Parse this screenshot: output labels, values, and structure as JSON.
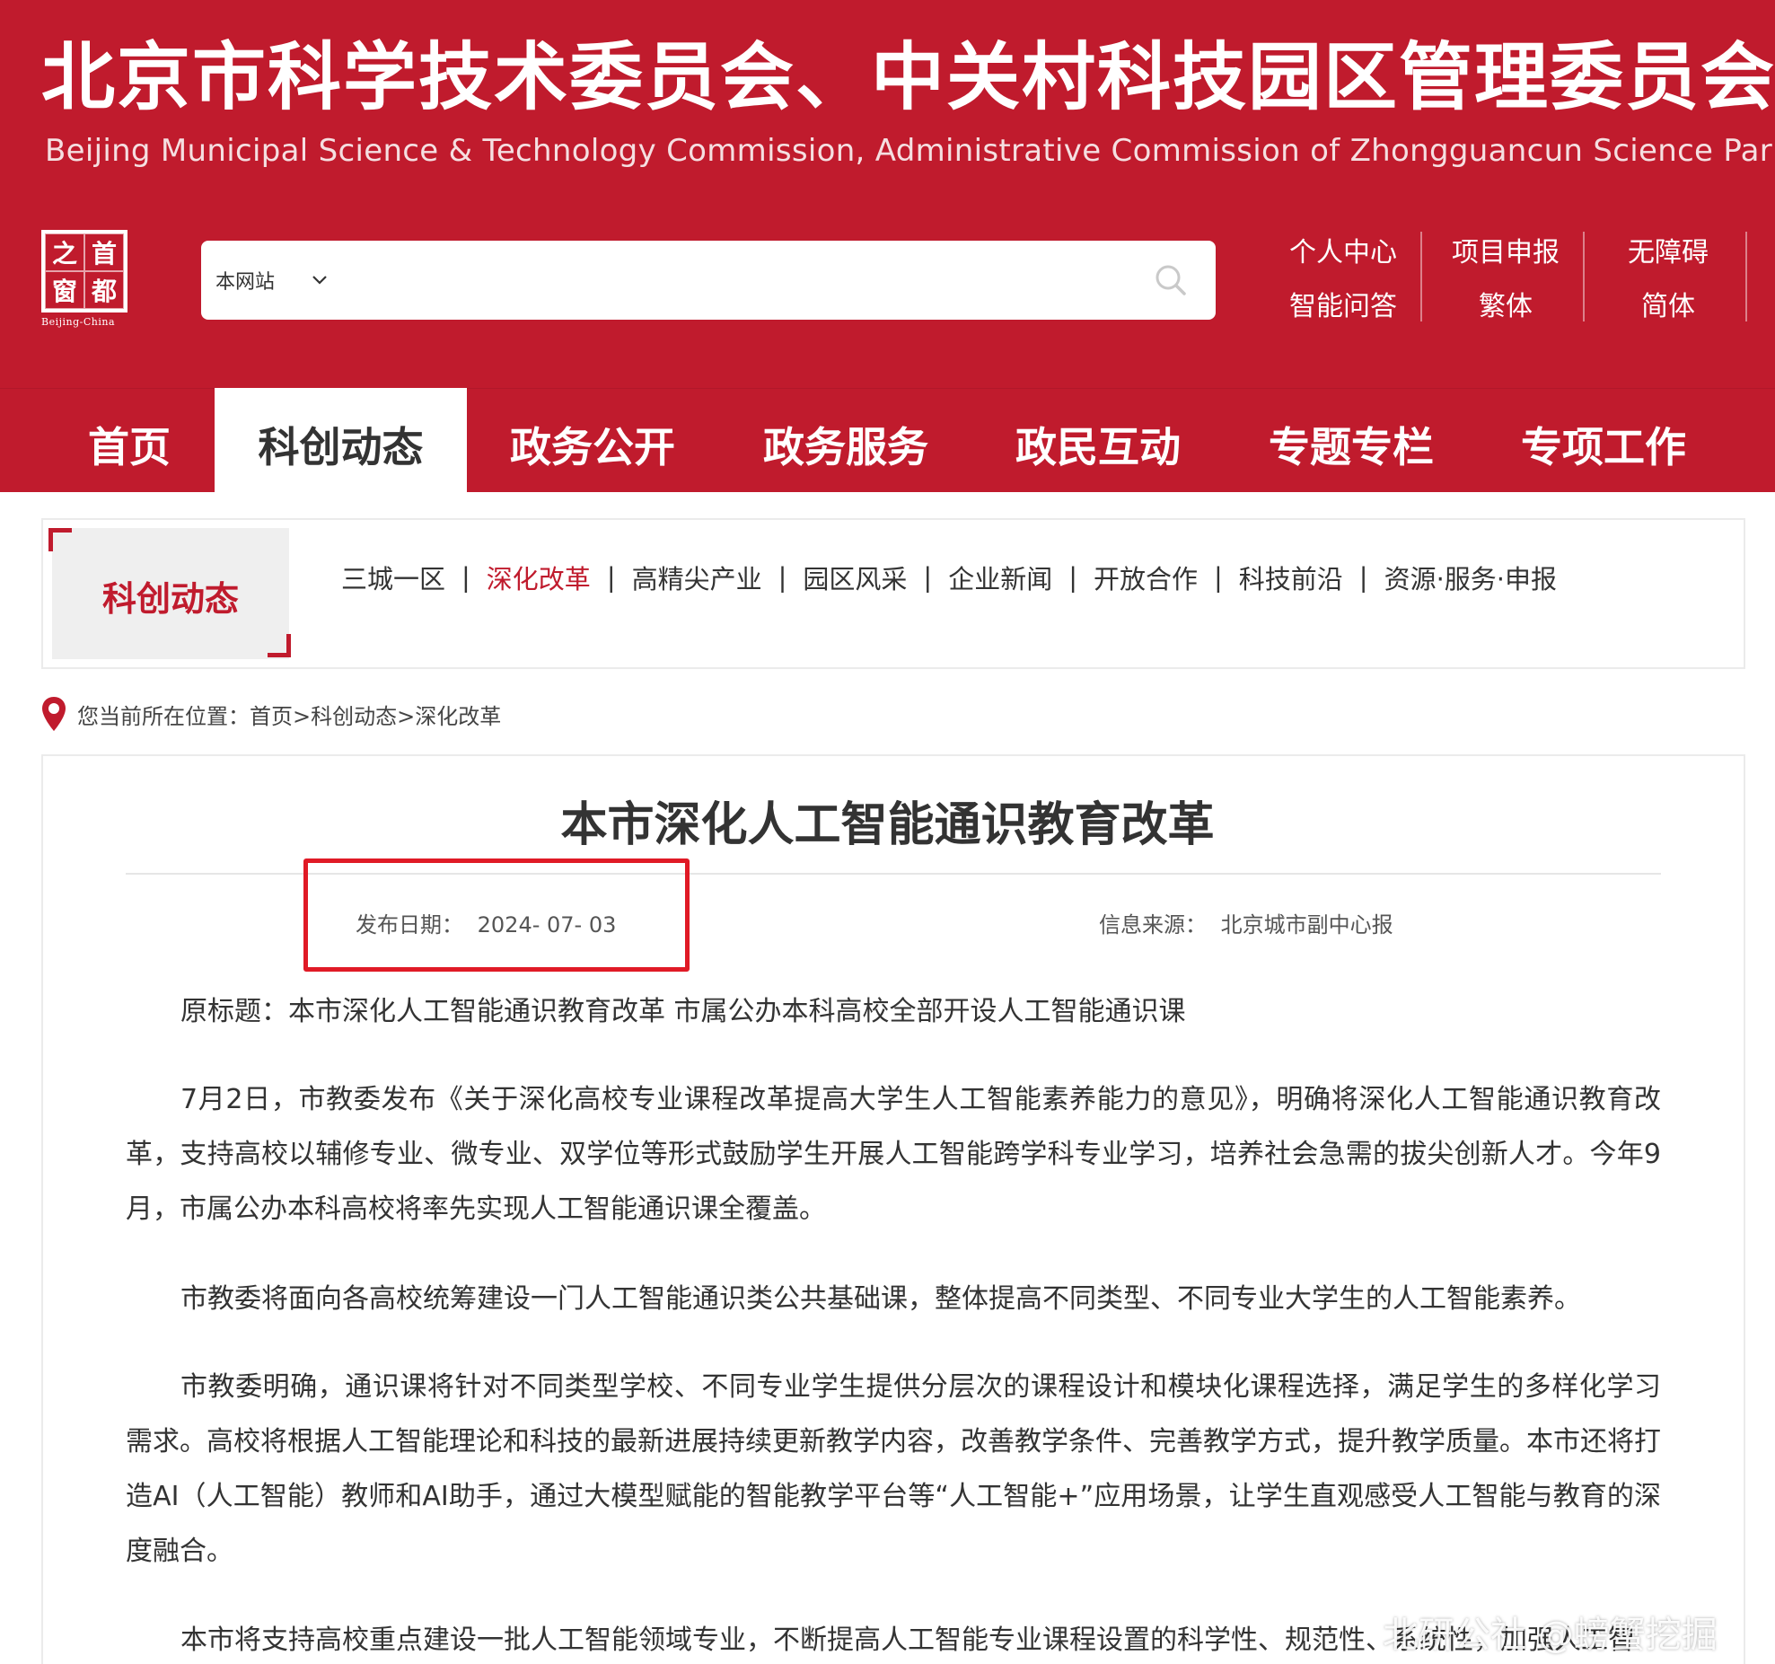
{
  "header": {
    "title_cn": "北京市科学技术委员会、中关村科技园区管理委员会",
    "title_en": "Beijing Municipal Science & Technology Commission, Administrative Commission of Zhongguancun Science Park",
    "logo_chars": [
      "之",
      "首",
      "窗",
      "都"
    ],
    "logo_caption": "Beijing-China",
    "search": {
      "scope": "本网站",
      "placeholder": ""
    },
    "util_links": [
      [
        "个人中心",
        "项目申报",
        "无障碍"
      ],
      [
        "智能问答",
        "繁体",
        "简体"
      ]
    ]
  },
  "nav": {
    "items": [
      "首页",
      "科创动态",
      "政务公开",
      "政务服务",
      "政民互动",
      "专题专栏",
      "专项工作"
    ],
    "active": "科创动态"
  },
  "section": {
    "label": "科创动态",
    "subnav": [
      "三城一区",
      "深化改革",
      "高精尖产业",
      "园区风采",
      "企业新闻",
      "开放合作",
      "科技前沿",
      "资源·服务·申报"
    ],
    "active": "深化改革"
  },
  "breadcrumb": {
    "label": "您当前所在位置：",
    "path": "首页>科创动态>深化改革"
  },
  "article": {
    "title": "本市深化人工智能通识教育改革",
    "date_label": "发布日期：",
    "date": "2024- 07- 03",
    "source_label": "信息来源：",
    "source": "北京城市副中心报",
    "paragraphs": [
      "原标题：本市深化人工智能通识教育改革 市属公办本科高校全部开设人工智能通识课",
      "7月2日，市教委发布《关于深化高校专业课程改革提高大学生人工智能素养能力的意见》，明确将深化人工智能通识教育改革，支持高校以辅修专业、微专业、双学位等形式鼓励学生开展人工智能跨学科专业学习，培养社会急需的拔尖创新人才。今年9月，市属公办本科高校将率先实现人工智能通识课全覆盖。",
      "市教委将面向各高校统筹建设一门人工智能通识类公共基础课，整体提高不同类型、不同专业大学生的人工智能素养。",
      "市教委明确，通识课将针对不同类型学校、不同专业学生提供分层次的课程设计和模块化课程选择，满足学生的多样化学习需求。高校将根据人工智能理论和科技的最新进展持续更新教学内容，改善教学条件、完善教学方式，提升教学质量。本市还将打造AI（人工智能）教师和AI助手，通过大模型赋能的智能教学平台等“人工智能+”应用场景，让学生直观感受人工智能与教育的深度融合。",
      "本市将支持高校重点建设一批人工智能领域专业，不断提高人工智能专业课程设置的科学性、规范性、系统性，加强人工智"
    ]
  },
  "watermark": "北研公社 @螃蟹挖掘",
  "colors": {
    "brand": "#c01b2d",
    "highlight": "#e01a26",
    "text": "#333333"
  }
}
